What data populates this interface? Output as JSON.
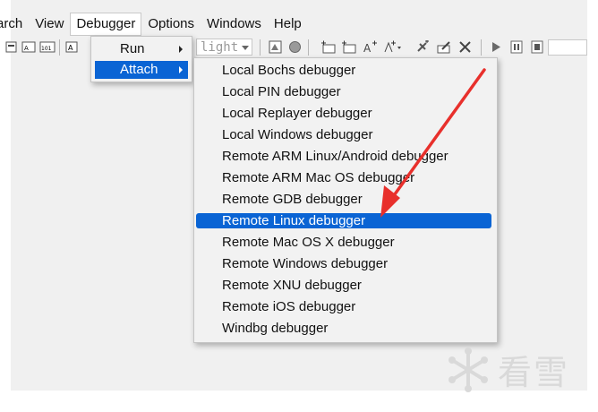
{
  "menubar": {
    "items": [
      "arch",
      "View",
      "Debugger",
      "Options",
      "Windows",
      "Help"
    ]
  },
  "toolbar": {
    "combo_value": "light"
  },
  "debugger_menu": {
    "items": [
      "Run",
      "Attach"
    ]
  },
  "attach_menu": {
    "items": [
      "Local Bochs debugger",
      "Local PIN debugger",
      "Local Replayer debugger",
      "Local Windows debugger",
      "Remote ARM Linux/Android debugger",
      "Remote ARM Mac OS debugger",
      "Remote GDB debugger",
      "Remote Linux debugger",
      "Remote Mac OS X debugger",
      "Remote Windows debugger",
      "Remote XNU debugger",
      "Remote iOS debugger",
      "Windbg debugger"
    ],
    "highlighted_index": 7
  },
  "watermark": {
    "text": "看雪"
  },
  "colors": {
    "highlight": "#0a64d4",
    "annotation_arrow": "#e8302c"
  }
}
